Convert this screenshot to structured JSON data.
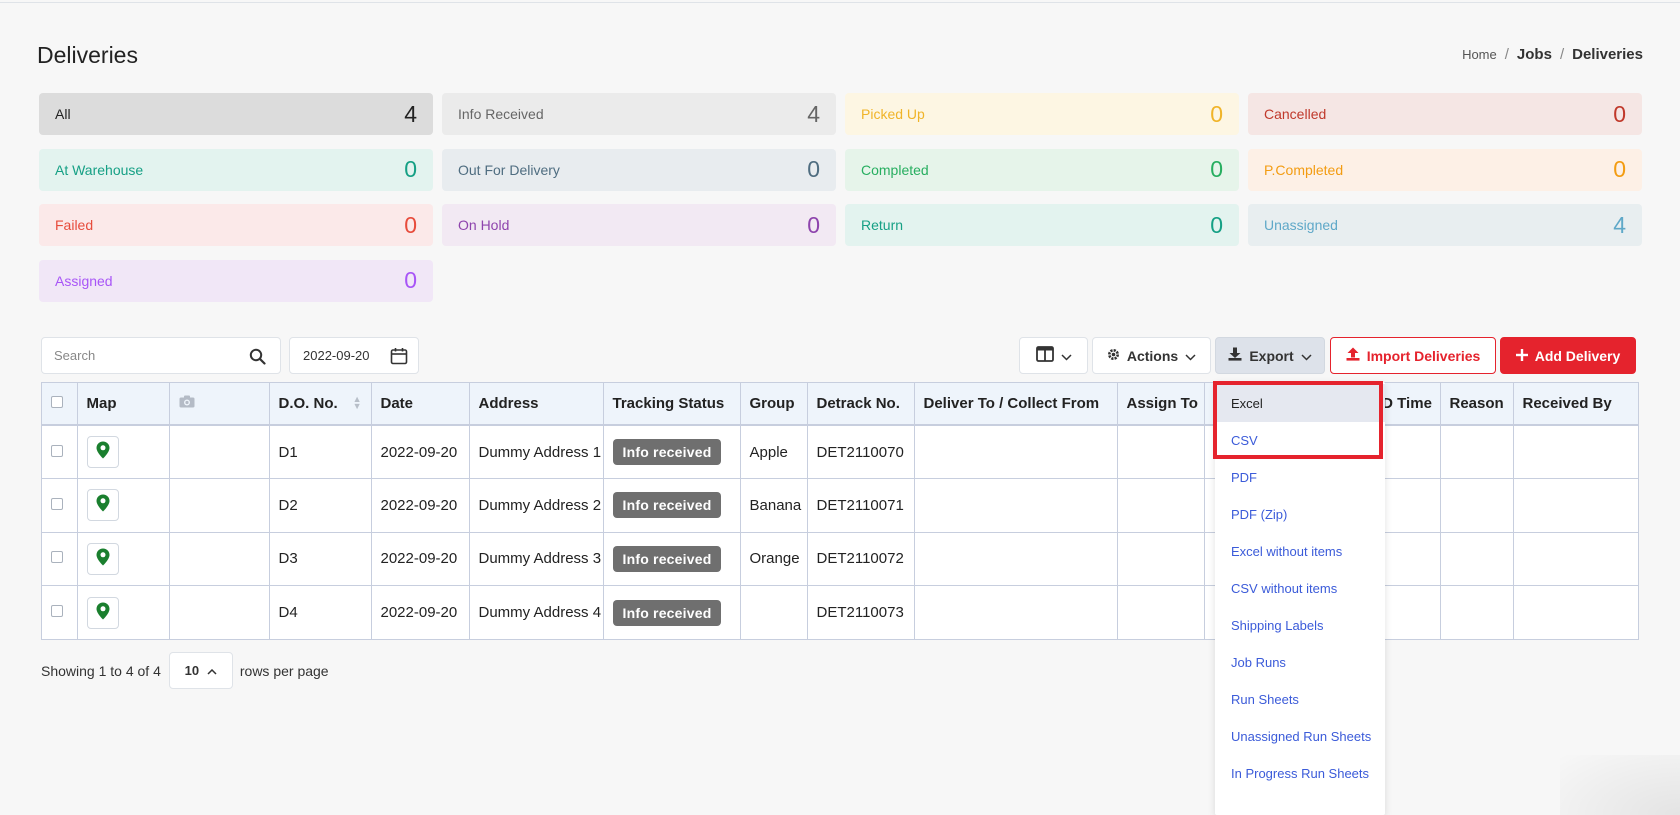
{
  "page": {
    "title": "Deliveries"
  },
  "breadcrumb": {
    "home": "Home",
    "separator": "/",
    "jobs": "Jobs",
    "current": "Deliveries"
  },
  "status_tiles": [
    {
      "label": "All",
      "count": "4",
      "bg": "#dcdcdc",
      "color": "#222222"
    },
    {
      "label": "Info Received",
      "count": "4",
      "bg": "#ebebeb",
      "color": "#666666"
    },
    {
      "label": "Picked Up",
      "count": "0",
      "bg": "#fdf6e3",
      "color": "#f0b429"
    },
    {
      "label": "Cancelled",
      "count": "0",
      "bg": "#f5e6e4",
      "color": "#c0392b"
    },
    {
      "label": "At Warehouse",
      "count": "0",
      "bg": "#e3f3ef",
      "color": "#16a085"
    },
    {
      "label": "Out For Delivery",
      "count": "0",
      "bg": "#e8ecef",
      "color": "#4f6d80"
    },
    {
      "label": "Completed",
      "count": "0",
      "bg": "#e6f4ea",
      "color": "#27ae60"
    },
    {
      "label": "P.Completed",
      "count": "0",
      "bg": "#fdf0e6",
      "color": "#f39c12"
    },
    {
      "label": "Failed",
      "count": "0",
      "bg": "#fbe9e9",
      "color": "#e74c3c"
    },
    {
      "label": "On Hold",
      "count": "0",
      "bg": "#f2e9f3",
      "color": "#8e44ad"
    },
    {
      "label": "Return",
      "count": "0",
      "bg": "#e3f3ef",
      "color": "#16a085"
    },
    {
      "label": "Unassigned",
      "count": "4",
      "bg": "#e8eef0",
      "color": "#5fa8c8"
    },
    {
      "label": "Assigned",
      "count": "0",
      "bg": "#f1e7f7",
      "color": "#a855f7"
    }
  ],
  "toolbar": {
    "search_placeholder": "Search",
    "date_value": "2022-09-20",
    "actions_label": "Actions",
    "export_label": "Export",
    "import_label": "Import Deliveries",
    "add_label": "Add Delivery"
  },
  "table": {
    "columns": [
      "",
      "Map",
      "",
      "D.O. No.",
      "Date",
      "Address",
      "Tracking Status",
      "Group",
      "Detrack No.",
      "Deliver To / Collect From",
      "Assign To",
      "",
      "OD Time",
      "Reason",
      "Received By"
    ],
    "rows": [
      {
        "do_no": "D1",
        "date": "2022-09-20",
        "address": "Dummy Address 1",
        "status": "Info received",
        "group": "Apple",
        "detrack_no": "DET2110070"
      },
      {
        "do_no": "D2",
        "date": "2022-09-20",
        "address": "Dummy Address 2",
        "status": "Info received",
        "group": "Banana",
        "detrack_no": "DET2110071"
      },
      {
        "do_no": "D3",
        "date": "2022-09-20",
        "address": "Dummy Address 3",
        "status": "Info received",
        "group": "Orange",
        "detrack_no": "DET2110072"
      },
      {
        "do_no": "D4",
        "date": "2022-09-20",
        "address": "Dummy Address 4",
        "status": "Info received",
        "group": "",
        "detrack_no": "DET2110073"
      }
    ]
  },
  "pagination": {
    "showing": "Showing 1 to 4 of 4",
    "per_page": "10",
    "rows_label": "rows per page"
  },
  "export_menu": {
    "items": [
      "Excel",
      "CSV",
      "PDF",
      "PDF (Zip)",
      "Excel without items",
      "CSV without items",
      "Shipping Labels",
      "Job Runs",
      "Run Sheets",
      "Unassigned Run Sheets",
      "In Progress Run Sheets"
    ],
    "active_index": 0
  },
  "icons": {
    "search": "search-icon",
    "calendar": "calendar-icon",
    "columns": "columns-icon",
    "gear": "gear-icon",
    "download": "download-icon",
    "upload": "upload-icon",
    "plus": "plus-icon",
    "map_pin": "map-pin-icon",
    "camera": "camera-icon"
  },
  "colors": {
    "accent_red": "#e5232d",
    "link_blue": "#3b5bd9",
    "map_pin_green": "#1a7f2e",
    "status_badge": "#6f6f6f"
  }
}
